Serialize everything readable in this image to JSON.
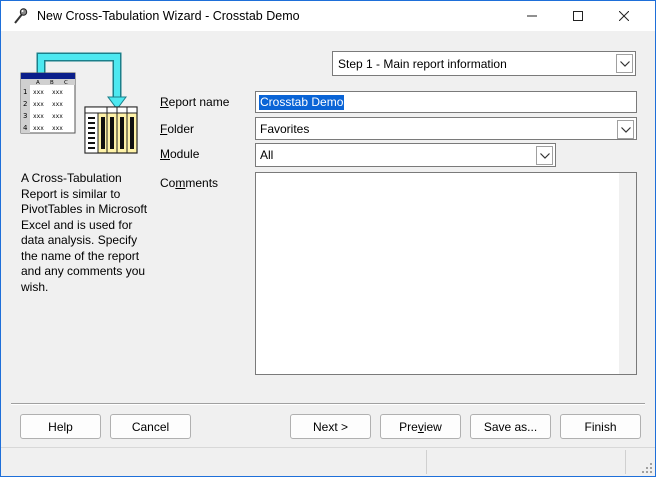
{
  "window": {
    "title": "New Cross-Tabulation Wizard - Crosstab Demo",
    "controls": {
      "minimize": "—",
      "maximize": "☐",
      "close": "✕"
    }
  },
  "step_selector": {
    "value": "Step 1 - Main report information"
  },
  "illustration": {
    "sheet_headers": [
      "A",
      "B",
      "C"
    ],
    "sheet_rows": [
      "1",
      "2",
      "3",
      "4"
    ],
    "cell_text": "xxx",
    "accent_color": "#4de8f0",
    "header_color": "#0b1f8a",
    "pivot_fill": "#fff3a8"
  },
  "description": "A Cross-Tabulation Report is similar to PivotTables in Microsoft Excel and is used for data analysis. Specify the name of the report and any comments you wish.",
  "form": {
    "report_name": {
      "label_u": "R",
      "label_rest": "eport name",
      "value": "Crosstab Demo",
      "selection_color": "#0a64d6"
    },
    "folder": {
      "label_u": "F",
      "label_rest": "older",
      "value": "Favorites"
    },
    "module": {
      "label_u": "M",
      "label_rest": "odule",
      "value": "All"
    },
    "comments": {
      "label_pre": "Co",
      "label_u": "m",
      "label_rest": "ments",
      "value": ""
    }
  },
  "buttons": {
    "help": "Help",
    "cancel": "Cancel",
    "next": "Next >",
    "preview_pre": "Pre",
    "preview_u": "v",
    "preview_rest": "iew",
    "save_as": "Save as...",
    "finish": "Finish"
  }
}
